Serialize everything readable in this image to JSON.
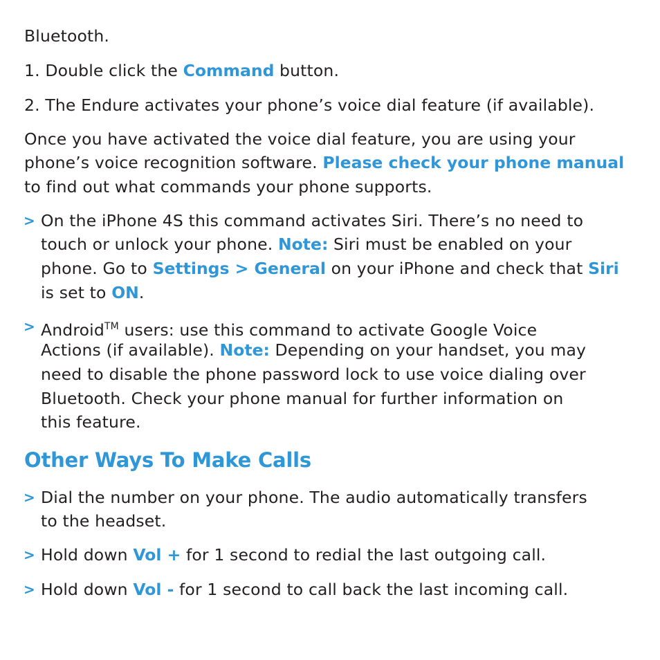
{
  "colors": {
    "accent": "#2f96d8",
    "text": "#231f20",
    "background": "#ffffff"
  },
  "bullet_glyph": ">",
  "intro": {
    "line_bluetooth": "Bluetooth.",
    "step1": {
      "pre": "1. Double click the ",
      "hl": "Command",
      "post": " button."
    },
    "step2": "2. The Endure activates your phone’s voice dial feature (if available)."
  },
  "para": {
    "l1": "Once you have activated the voice dial feature, you are using your",
    "l2_pre": "phone’s voice recognition software. ",
    "l2_hl": "Please check your phone manual",
    "l3": "to find out what commands your phone supports."
  },
  "bullet_iphone": {
    "l1": "On the iPhone 4S this command activates Siri. There’s no need to",
    "l2_pre": "touch or unlock your phone. ",
    "l2_hl": "Note:",
    "l2_post": " Siri must be enabled on your",
    "l3_pre": "phone. Go to ",
    "l3_hl": "Settings > General",
    "l3_mid": " on your iPhone and check that ",
    "l3_hl2": "Siri",
    "l4_pre": "is set to ",
    "l4_hl": "ON",
    "l4_post": "."
  },
  "bullet_android": {
    "l1_pre": "Android",
    "l1_tm": "TM",
    "l1_post": " users: use this command to activate Google Voice",
    "l2_pre": "Actions (if available). ",
    "l2_hl": "Note:",
    "l2_post": " Depending on your handset, you may",
    "l3": "need to disable the phone password lock to use voice dialing over",
    "l4": "Bluetooth. Check your phone manual for further information on",
    "l5": "this feature."
  },
  "section_heading": "Other Ways To Make Calls",
  "bullet_dial": {
    "l1": "Dial the number on your phone. The audio automatically transfers",
    "l2": "to the headset."
  },
  "bullet_volplus": {
    "pre": "Hold down ",
    "hl": "Vol +",
    "post": " for 1 second to redial the last outgoing call."
  },
  "bullet_volminus": {
    "pre": "Hold down ",
    "hl": "Vol -",
    "post": " for 1 second to call back the last incoming call."
  }
}
